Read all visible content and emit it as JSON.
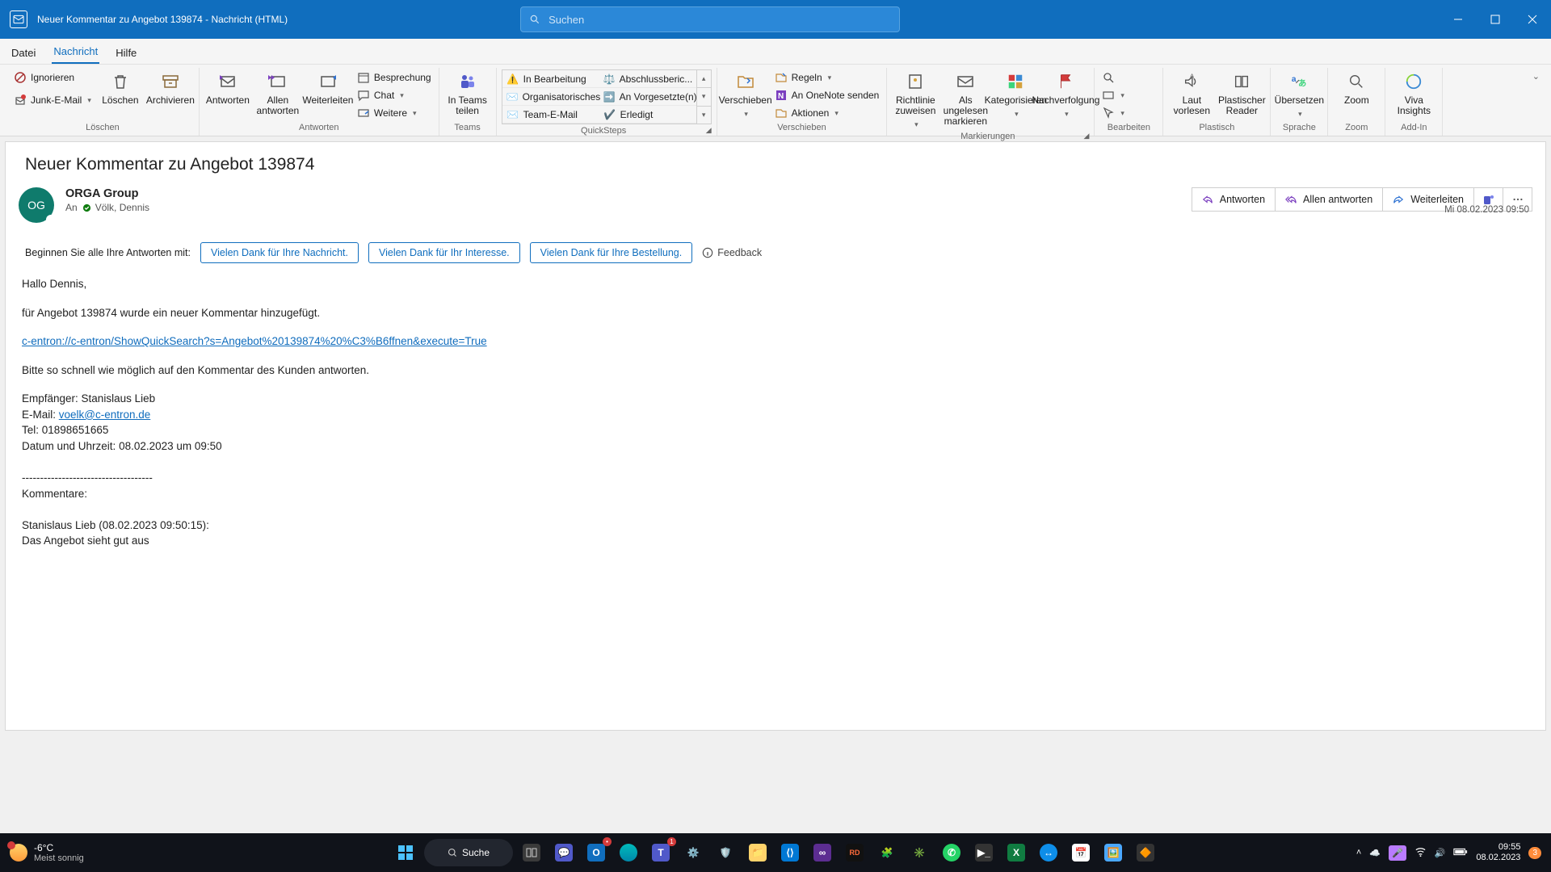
{
  "titlebar": {
    "title": "Neuer Kommentar zu Angebot 139874  -  Nachricht (HTML)",
    "search_placeholder": "Suchen"
  },
  "menu": {
    "file": "Datei",
    "message": "Nachricht",
    "help": "Hilfe"
  },
  "ribbon": {
    "ignore": "Ignorieren",
    "junk": "Junk-E-Mail",
    "delete": "Löschen",
    "archive": "Archivieren",
    "g_delete": "Löschen",
    "reply": "Antworten",
    "replyall": "Allen antworten",
    "forward": "Weiterleiten",
    "meeting": "Besprechung",
    "chat": "Chat",
    "more": "Weitere",
    "g_reply": "Antworten",
    "teams_share": "In Teams teilen",
    "g_teams": "Teams",
    "qs_inprogress": "In Bearbeitung",
    "qs_org": "Organisatorisches",
    "qs_team": "Team-E-Mail",
    "qs_close": "Abschlussberic...",
    "qs_mgr": "An Vorgesetzte(n)",
    "qs_done": "Erledigt",
    "g_qs": "QuickSteps",
    "move": "Verschieben",
    "rules": "Regeln",
    "onenote": "An OneNote senden",
    "actions": "Aktionen",
    "g_move": "Verschieben",
    "policy": "Richtlinie zuweisen",
    "unread": "Als ungelesen markieren",
    "categorize": "Kategorisieren",
    "followup": "Nachverfolgung",
    "g_mark": "Markierungen",
    "edit": "Bearbeiten",
    "g_edit": "Bearbeiten",
    "readaloud": "Laut vorlesen",
    "immersive": "Plastischer Reader",
    "g_immersive": "Plastisch",
    "translate": "Übersetzen",
    "g_lang": "Sprache",
    "zoom": "Zoom",
    "g_zoom": "Zoom",
    "viva": "Viva Insights",
    "g_addin": "Add-In"
  },
  "message": {
    "subject": "Neuer Kommentar zu Angebot 139874",
    "avatar_initials": "OG",
    "sender": "ORGA Group",
    "to_label": "An",
    "to_name": "Völk, Dennis",
    "timestamp": "Mi 08.02.2023 09:50",
    "actions": {
      "reply": "Antworten",
      "replyall": "Allen antworten",
      "forward": "Weiterleiten"
    }
  },
  "suggest": {
    "prefix": "Beginnen Sie alle Ihre Antworten mit:",
    "chip1": "Vielen Dank für Ihre Nachricht.",
    "chip2": "Vielen Dank für Ihr Interesse.",
    "chip3": "Vielen Dank für Ihre Bestellung.",
    "feedback": "Feedback"
  },
  "body": {
    "greeting": "Hallo Dennis,",
    "line1": "für Angebot 139874 wurde ein neuer Kommentar hinzugefügt.",
    "link": "c-entron://c-entron/ShowQuickSearch?s=Angebot%20139874%20%C3%B6ffnen&execute=True",
    "line2": "Bitte so schnell wie möglich auf den Kommentar des Kunden antworten.",
    "recipient_lbl": "Empfänger: ",
    "recipient": "Stanislaus Lieb",
    "email_lbl": "E-Mail: ",
    "email": "voelk@c-entron.de",
    "tel_lbl": "Tel: ",
    "tel": "01898651665",
    "dt_lbl": "Datum und Uhrzeit: ",
    "dt": "08.02.2023 um 09:50",
    "sep": "------------------------------------",
    "comments_lbl": "Kommentare:",
    "comment_author": "Stanislaus Lieb (08.02.2023 09:50:15):",
    "comment_text": "Das Angebot sieht gut aus"
  },
  "taskbar": {
    "temp": "-6°C",
    "weather": "Meist sonnig",
    "search": "Suche",
    "time": "09:55",
    "date": "08.02.2023",
    "notif_count": "3"
  }
}
